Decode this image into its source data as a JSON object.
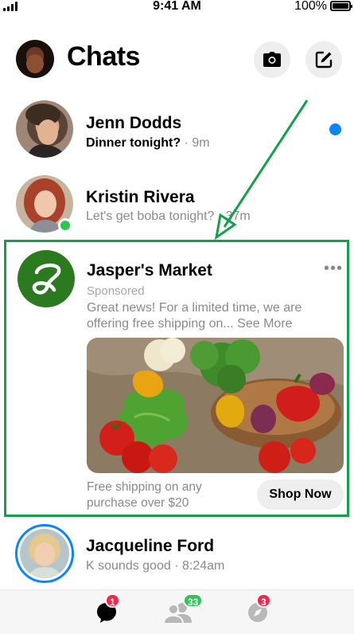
{
  "status_bar": {
    "time": "9:41 AM",
    "battery": "100%",
    "battery_level": 1.0
  },
  "header": {
    "title": "Chats",
    "icons": [
      "camera-icon",
      "compose-icon"
    ]
  },
  "chats": [
    {
      "name": "Jenn Dodds",
      "message": "Dinner tonight?",
      "separator": " · ",
      "time": "9m",
      "unread": true
    },
    {
      "name": "Kristin Rivera",
      "message": "Let's get boba tonight?",
      "separator": " · ",
      "time": "37m",
      "online": true
    }
  ],
  "ad": {
    "name": "Jasper's Market",
    "sponsored": "Sponsored",
    "body": "Great news! For a limited time, we are offering free shipping on...",
    "see_more": "See More",
    "more_options": "•••",
    "footer_text": "Free shipping on any purchase over $20",
    "cta": "Shop Now"
  },
  "chats_after": [
    {
      "name": "Jacqueline Ford",
      "message": "K sounds good",
      "separator": " · ",
      "time": "8:24am"
    }
  ],
  "tab_bar": {
    "tabs": [
      {
        "icon": "chat-bubble-icon",
        "badge": "1",
        "badge_color": "#f02849"
      },
      {
        "icon": "people-icon",
        "badge": "33",
        "badge_color": "#2dc653"
      },
      {
        "icon": "discover-compass-icon",
        "badge": "3",
        "badge_color": "#f02849"
      }
    ]
  },
  "colors": {
    "highlight_border": "#13a04a",
    "unread_dot": "#0a84ff",
    "online": "#2dc653",
    "badge_red": "#f02849"
  }
}
